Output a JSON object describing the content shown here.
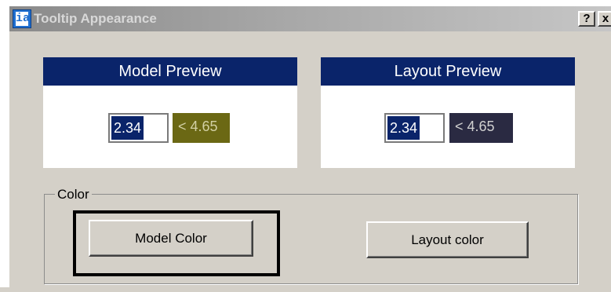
{
  "window": {
    "title": "Tooltip Appearance",
    "app_icon_glyph": "ia",
    "help_label": "?",
    "close_label": "x"
  },
  "model_preview": {
    "header": "Model Preview",
    "value": "2.34",
    "tooltip": "< 4.65",
    "tooltip_bg": "#6b6814"
  },
  "layout_preview": {
    "header": "Layout Preview",
    "value": "2.34",
    "tooltip": "< 4.65",
    "tooltip_bg": "#2a2a42"
  },
  "color_group": {
    "legend": "Color",
    "model_button": "Model Color",
    "layout_button": "Layout color"
  },
  "colors": {
    "panel_header": "#0a246a",
    "dialog_face": "#d4d0c8"
  }
}
